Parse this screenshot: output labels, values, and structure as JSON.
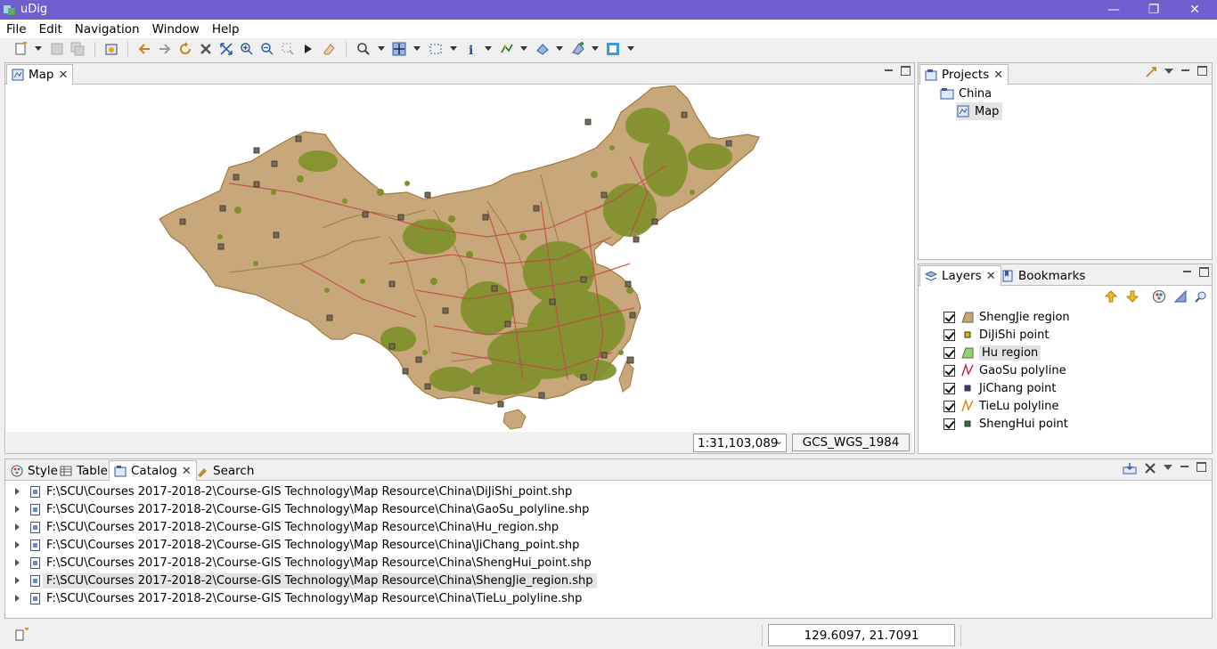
{
  "window": {
    "title": "uDig",
    "minimize": "—",
    "restore": "❐",
    "close": "✕"
  },
  "menu": [
    "File",
    "Edit",
    "Navigation",
    "Window",
    "Help"
  ],
  "map_view": {
    "tab_label": "Map",
    "scale": "1:31,103,089",
    "crs": "GCS_WGS_1984"
  },
  "projects": {
    "tab_label": "Projects",
    "project_name": "China",
    "map_item": "Map"
  },
  "layers_panel": {
    "tab_label": "Layers",
    "bookmarks_tab": "Bookmarks",
    "layers": [
      {
        "label": "ShengJie region",
        "icon": "polygon-icon",
        "color": "#c8a86c",
        "checked": true
      },
      {
        "label": "DiJiShi point",
        "icon": "point-icon",
        "color": "#e8b800",
        "checked": true
      },
      {
        "label": "Hu region",
        "icon": "polygon-icon",
        "color": "#8fd46a",
        "checked": true
      },
      {
        "label": "GaoSu polyline",
        "icon": "line-icon",
        "color": "#b8205a",
        "checked": true
      },
      {
        "label": "JiChang point",
        "icon": "point-icon",
        "color": "#3a3a8a",
        "checked": true
      },
      {
        "label": "TieLu polyline",
        "icon": "line-icon",
        "color": "#d08a1a",
        "checked": true
      },
      {
        "label": "ShengHui point",
        "icon": "point-icon",
        "color": "#1a7a3a",
        "checked": true
      }
    ]
  },
  "bottom_tabs": [
    "Style",
    "Table",
    "Catalog",
    "Search"
  ],
  "catalog": {
    "items": [
      "F:\\SCU\\Courses 2017-2018-2\\Course-GIS Technology\\Map Resource\\China\\DiJiShi_point.shp",
      "F:\\SCU\\Courses 2017-2018-2\\Course-GIS Technology\\Map Resource\\China\\GaoSu_polyline.shp",
      "F:\\SCU\\Courses 2017-2018-2\\Course-GIS Technology\\Map Resource\\China\\Hu_region.shp",
      "F:\\SCU\\Courses 2017-2018-2\\Course-GIS Technology\\Map Resource\\China\\JiChang_point.shp",
      "F:\\SCU\\Courses 2017-2018-2\\Course-GIS Technology\\Map Resource\\China\\ShengHui_point.shp",
      "F:\\SCU\\Courses 2017-2018-2\\Course-GIS Technology\\Map Resource\\China\\ShengJie_region.shp",
      "F:\\SCU\\Courses 2017-2018-2\\Course-GIS Technology\\Map Resource\\China\\TieLu_polyline.shp"
    ],
    "selected_index": 5
  },
  "status": {
    "coordinates": "129.6097, 21.7091"
  },
  "colors": {
    "titlebar": "#6f5fcf",
    "land": "#c8a87a",
    "green": "#7f8f2a",
    "road": "#c04848"
  }
}
